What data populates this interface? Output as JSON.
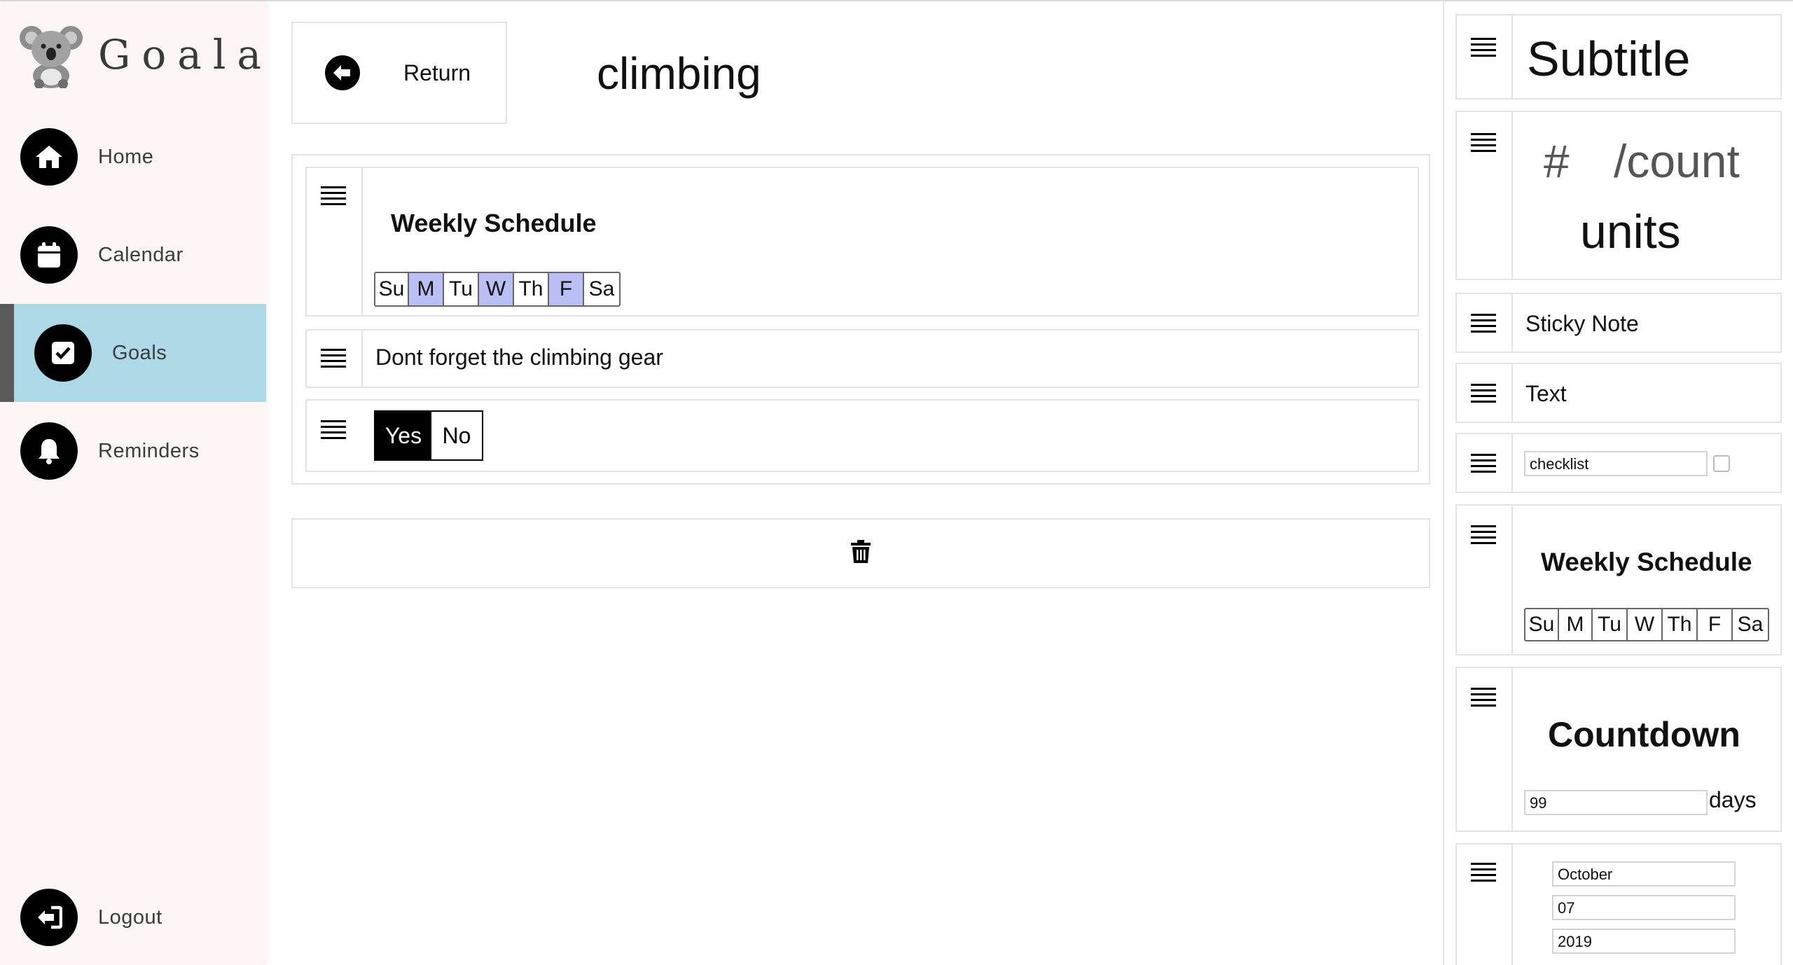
{
  "app": {
    "brand": "Goala"
  },
  "sidebar": {
    "items": [
      {
        "label": "Home",
        "icon": "home-icon"
      },
      {
        "label": "Calendar",
        "icon": "calendar-icon"
      },
      {
        "label": "Goals",
        "icon": "checkbox-icon",
        "active": true
      },
      {
        "label": "Reminders",
        "icon": "bell-icon"
      }
    ],
    "logout": {
      "label": "Logout",
      "icon": "logout-icon"
    }
  },
  "header": {
    "return_label": "Return",
    "title": "climbing"
  },
  "board": {
    "schedule": {
      "title": "Weekly Schedule",
      "days": [
        {
          "label": "Su",
          "on": false
        },
        {
          "label": "M",
          "on": true
        },
        {
          "label": "Tu",
          "on": false
        },
        {
          "label": "W",
          "on": true
        },
        {
          "label": "Th",
          "on": false
        },
        {
          "label": "F",
          "on": true
        },
        {
          "label": "Sa",
          "on": false
        }
      ]
    },
    "note": {
      "text": "Dont forget the climbing gear"
    },
    "toggle": {
      "yes": "Yes",
      "no": "No",
      "selected": "Yes"
    }
  },
  "palette": {
    "subtitle": "Subtitle",
    "count": {
      "hash": "#",
      "slash": "/count",
      "units": "units"
    },
    "sticky": "Sticky Note",
    "text": "Text",
    "checklist": {
      "value": "checklist"
    },
    "weekly": {
      "title": "Weekly Schedule",
      "days": [
        "Su",
        "M",
        "Tu",
        "W",
        "Th",
        "F",
        "Sa"
      ]
    },
    "countdown": {
      "title": "Countdown",
      "value": "99",
      "unit": "days"
    },
    "date": {
      "month": "October",
      "day": "07",
      "year": "2019"
    }
  },
  "colors": {
    "active_nav": "#add8e6",
    "day_on": "#b9bff2",
    "sidebar_bg": "#fdf6f5"
  }
}
